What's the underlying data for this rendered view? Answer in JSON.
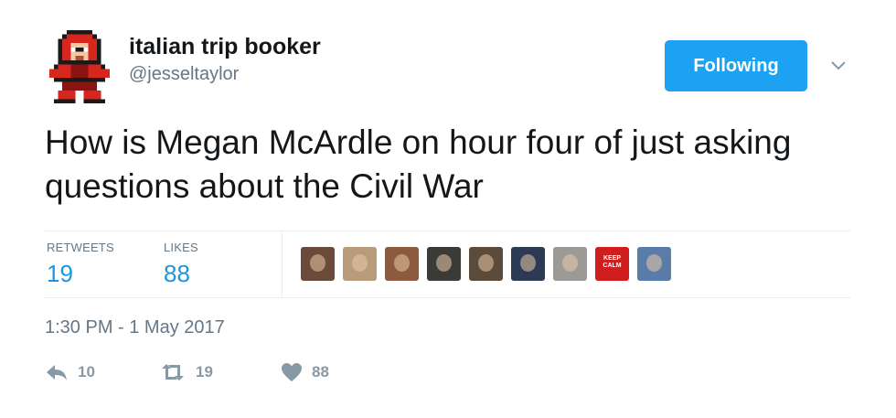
{
  "user": {
    "display_name": "italian trip booker",
    "handle": "@jesseltaylor",
    "avatar_icon": "megaman-pixel-avatar"
  },
  "follow_button": {
    "label": "Following",
    "color": "#1da1f2"
  },
  "menu_icon": "chevron-down-icon",
  "tweet": {
    "text": "How is Megan McArdle on hour four of just asking questions about the Civil War"
  },
  "stats": {
    "retweets": {
      "label": "RETWEETS",
      "count": "19"
    },
    "likes": {
      "label": "LIKES",
      "count": "88"
    }
  },
  "likers": [
    {
      "name": "liker-avatar-1",
      "color": "#6a4a3a"
    },
    {
      "name": "liker-avatar-2",
      "color": "#b89c7a"
    },
    {
      "name": "liker-avatar-3",
      "color": "#8c5a3c"
    },
    {
      "name": "liker-avatar-4",
      "color": "#3a3a36"
    },
    {
      "name": "liker-avatar-5",
      "color": "#5c4a3a"
    },
    {
      "name": "liker-avatar-6",
      "color": "#2c3a54"
    },
    {
      "name": "liker-avatar-7",
      "color": "#9a9a96"
    },
    {
      "name": "liker-avatar-8",
      "color": "#d01e1e",
      "text": "KEEP CALM"
    },
    {
      "name": "liker-avatar-9",
      "color": "#5a7ca8"
    }
  ],
  "timestamp": "1:30 PM - 1 May 2017",
  "actions": {
    "reply_count": "10",
    "retweet_count": "19",
    "like_count": "88"
  }
}
